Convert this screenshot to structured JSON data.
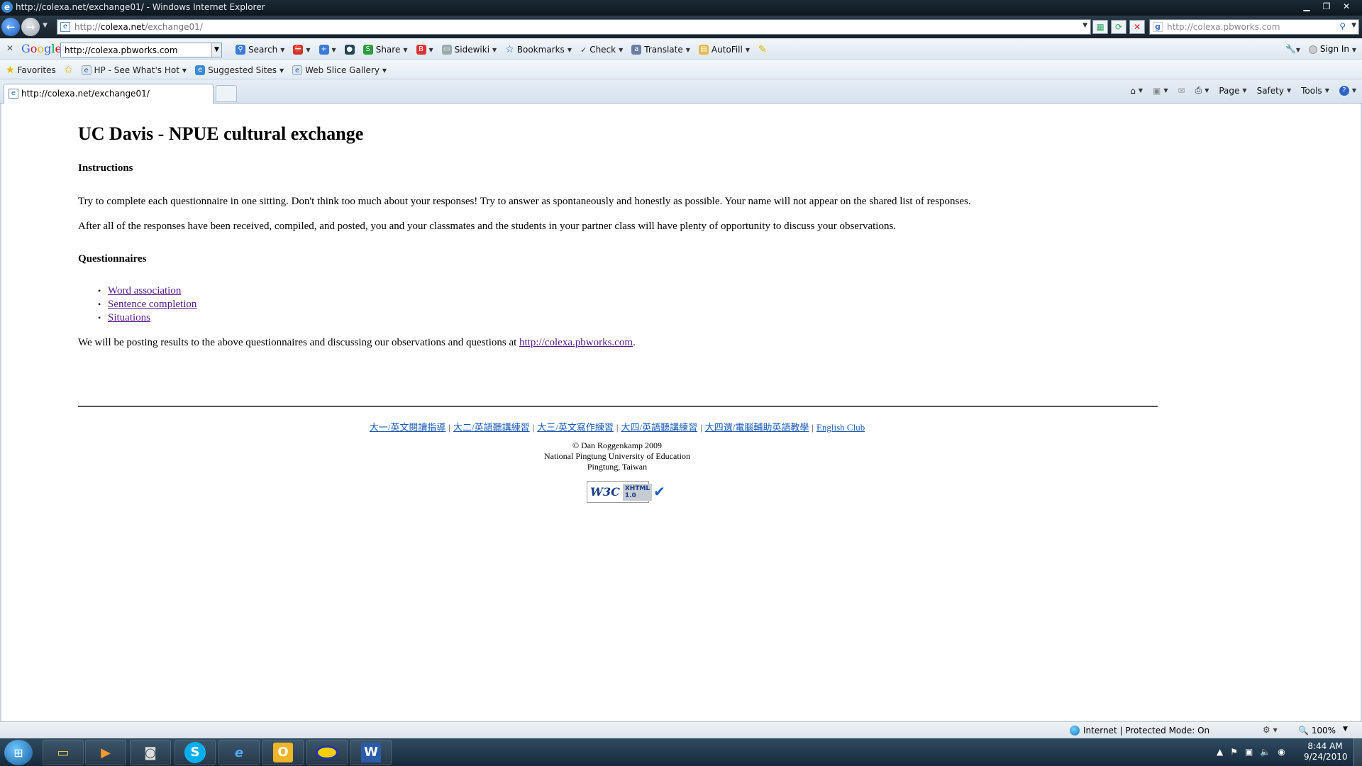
{
  "window": {
    "title": "http://colexa.net/exchange01/ - Windows Internet Explorer",
    "controls": [
      "minimize",
      "restore",
      "close"
    ]
  },
  "address_bar": {
    "url_prefix": "http://",
    "url_host": "colexa.net",
    "url_path": "/exchange01/",
    "search_text": "http://colexa.pbworks.com"
  },
  "google_toolbar": {
    "logo": "Google",
    "search_value": "http://colexa.pbworks.com",
    "items": {
      "search": "Search",
      "share": "Share",
      "sidewiki": "Sidewiki",
      "bookmarks": "Bookmarks",
      "check": "Check",
      "translate": "Translate",
      "autofill": "AutoFill"
    },
    "sign_in": "Sign In"
  },
  "favorites_bar": {
    "favorites": "Favorites",
    "items": [
      "HP - See What's Hot",
      "Suggested Sites",
      "Web Slice Gallery"
    ]
  },
  "tab": {
    "label": "http://colexa.net/exchange01/"
  },
  "command_bar": {
    "page": "Page",
    "safety": "Safety",
    "tools": "Tools"
  },
  "page": {
    "title": "UC Davis - NPUE cultural exchange",
    "instructions_heading": "Instructions",
    "paragraph1": "Try to complete each questionnaire in one sitting. Don't think too much about your responses! Try to answer as spontaneously and honestly as possible. Your name will not appear on the shared list of responses.",
    "paragraph2": "After all of the responses have been received, compiled, and posted, you and your classmates and the students in your partner class will have plenty of opportunity to discuss your observations.",
    "questionnaires_heading": "Questionnaires",
    "questionnaires": [
      "Word association",
      "Sentence completion",
      "Situations"
    ],
    "posting_text": "We will be posting results to the above questionnaires and discussing our observations and questions at",
    "posting_link": "http://colexa.pbworks.com",
    "posting_end": ".",
    "footer_links": [
      "大一/英文閱讀指導",
      "大二/英語聽講練習",
      "大三/英文寫作練習",
      "大四/英語聽講練習",
      "大四選/電腦輔助英語教學",
      "English Club"
    ],
    "footer_separator": "|",
    "copyright": "© Dan Roggenkamp 2009",
    "university": "National Pingtung University of Education",
    "location": "Pingtung, Taiwan",
    "badge": {
      "w3c": "W3C",
      "line1": "XHTML",
      "line2": "1.0"
    }
  },
  "status_bar": {
    "zone": "Internet | Protected Mode: On",
    "zoom": "100%"
  },
  "taskbar": {
    "apps": [
      "file-explorer",
      "media-player",
      "camera",
      "skype",
      "internet-explorer",
      "outlook",
      "app-eye",
      "word"
    ],
    "time": "8:44 AM",
    "date": "9/24/2010"
  }
}
